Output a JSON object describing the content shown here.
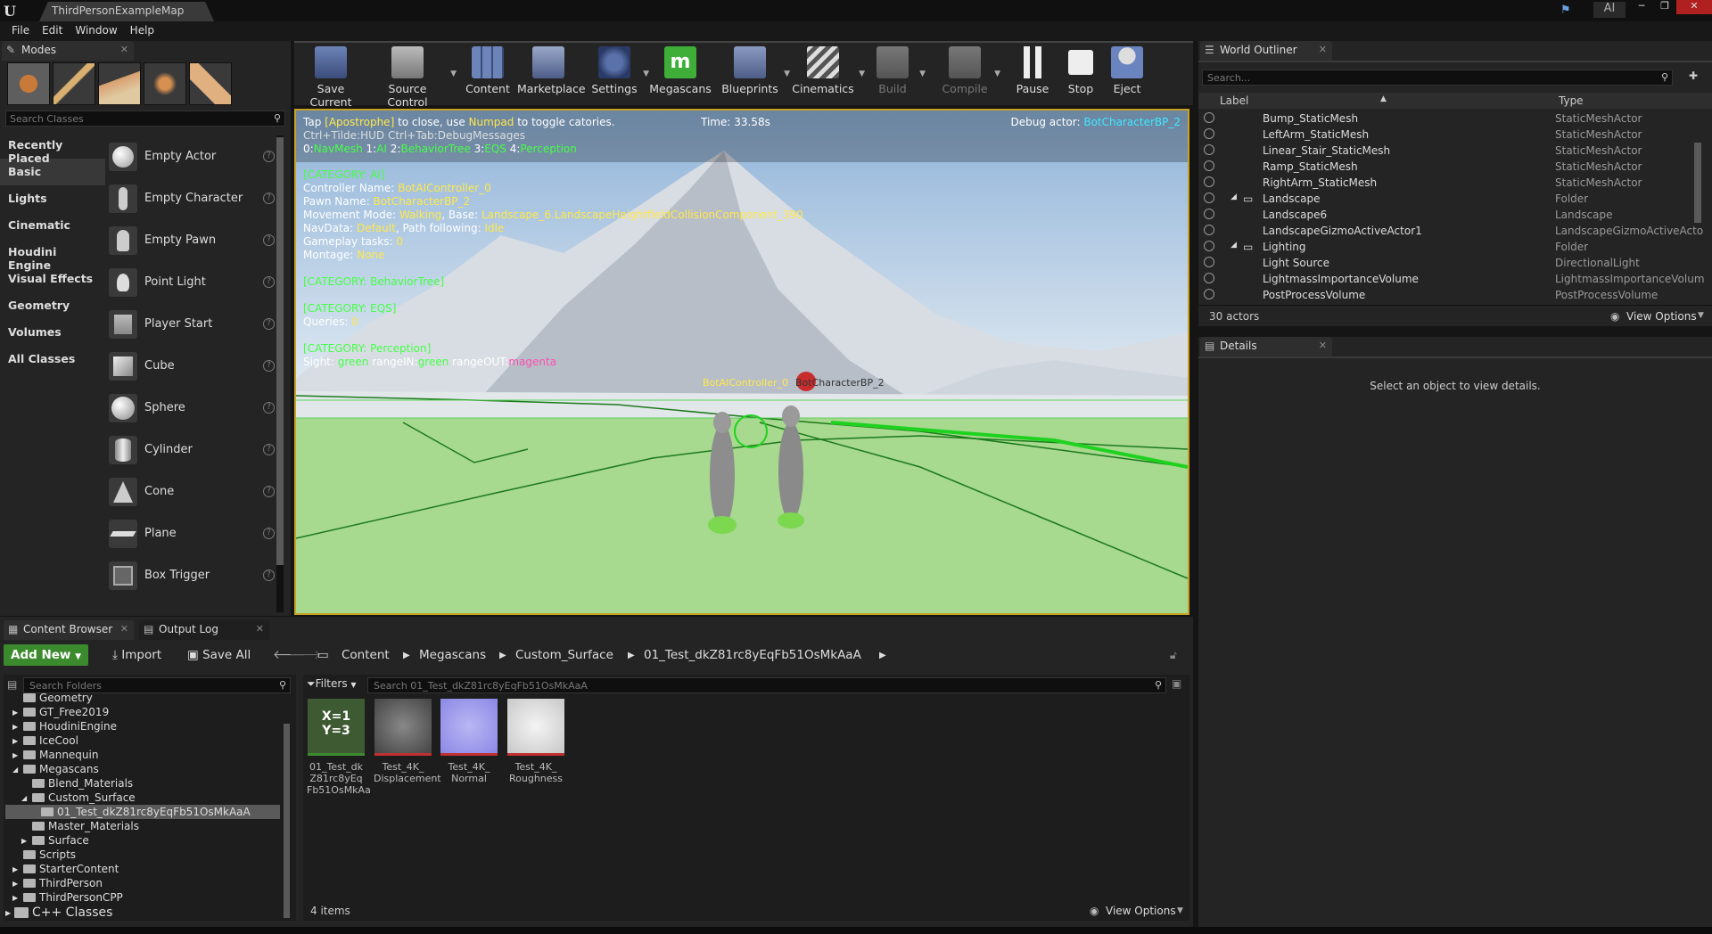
{
  "window": {
    "tab_title": "ThirdPersonExampleMap",
    "ai_label": "AI"
  },
  "menu": [
    "File",
    "Edit",
    "Window",
    "Help"
  ],
  "modes": {
    "title": "Modes",
    "search_placeholder": "Search Classes",
    "categories": [
      "Recently Placed",
      "Basic",
      "Lights",
      "Cinematic",
      "Houdini Engine",
      "Visual Effects",
      "Geometry",
      "Volumes",
      "All Classes"
    ],
    "selected_category": "Basic",
    "classes": [
      "Empty Actor",
      "Empty Character",
      "Empty Pawn",
      "Point Light",
      "Player Start",
      "Cube",
      "Sphere",
      "Cylinder",
      "Cone",
      "Plane",
      "Box Trigger"
    ]
  },
  "toolbar": {
    "save_current": "Save Current",
    "source_control": "Source Control",
    "content": "Content",
    "marketplace": "Marketplace",
    "settings": "Settings",
    "megascans": "Megascans",
    "blueprints": "Blueprints",
    "cinematics": "Cinematics",
    "build": "Build",
    "compile": "Compile",
    "pause": "Pause",
    "stop": "Stop",
    "eject": "Eject"
  },
  "viewport": {
    "hint_pre": "Tap ",
    "hint_key": "[Apostrophe]",
    "hint_mid": " to close, use ",
    "hint_numpad": "Numpad",
    "hint_post": " to toggle catories.",
    "line2": "Ctrl+Tilde:HUD  Ctrl+Tab:DebugMessages",
    "line3_0": "0:",
    "line3_navmesh": "NavMesh",
    "line3_1": " 1:",
    "line3_ai": "AI",
    "line3_2": " 2:",
    "line3_bt": "BehaviorTree",
    "line3_3": " 3:",
    "line3_eqs": "EQS",
    "line3_4": " 4:",
    "line3_perc": "Perception",
    "time": "Time: 33.58s",
    "debug_actor_label": "Debug actor: ",
    "debug_actor": "BotCharacterBP_2",
    "cat_ai": "[CATEGORY: AI]",
    "controller_label": "Controller Name: ",
    "controller": "BotAIController_0",
    "pawn_label": "Pawn Name: ",
    "pawn": "BotCharacterBP_2",
    "movement_label": "Movement Mode: ",
    "movement": "Walking",
    "base_label": ", Base: ",
    "base": "Landscape_6.LandscapeHeightfieldCollisionComponent_390",
    "navdata_label": "NavData: ",
    "navdata": "Default",
    "path_label": ", Path following: ",
    "path": "Idle",
    "gameplay_label": "Gameplay tasks: ",
    "gameplay": "0",
    "montage_label": "Montage: ",
    "montage": "None",
    "cat_bt": "[CATEGORY: BehaviorTree]",
    "cat_eqs": "[CATEGORY: EQS]",
    "queries_label": "Queries: ",
    "queries": "0",
    "cat_perc": "[CATEGORY: Perception]",
    "sight_label": "Sight: ",
    "sight": "green",
    "rangein_label": " rangeIN:",
    "rangein": "green",
    "rangeout_label": " rangeOUT:",
    "rangeout": "magenta",
    "overlay_controller": "BotAIController_0",
    "overlay_character": "BotCharacterBP_2"
  },
  "outliner": {
    "title": "World Outliner",
    "search_placeholder": "Search...",
    "col_label": "Label",
    "col_type": "Type",
    "rows": [
      {
        "label": "Bump_StaticMesh",
        "type": "StaticMeshActor"
      },
      {
        "label": "LeftArm_StaticMesh",
        "type": "StaticMeshActor"
      },
      {
        "label": "Linear_Stair_StaticMesh",
        "type": "StaticMeshActor"
      },
      {
        "label": "Ramp_StaticMesh",
        "type": "StaticMeshActor"
      },
      {
        "label": "RightArm_StaticMesh",
        "type": "StaticMeshActor"
      },
      {
        "label": "Landscape",
        "type": "Folder"
      },
      {
        "label": "Landscape6",
        "type": "Landscape"
      },
      {
        "label": "LandscapeGizmoActiveActor1",
        "type": "LandscapeGizmoActiveActo"
      },
      {
        "label": "Lighting",
        "type": "Folder"
      },
      {
        "label": "Light Source",
        "type": "DirectionalLight"
      },
      {
        "label": "LightmassImportanceVolume",
        "type": "LightmassImportanceVolum"
      },
      {
        "label": "PostProcessVolume",
        "type": "PostProcessVolume"
      }
    ],
    "count": "30 actors",
    "view_options": "View Options"
  },
  "details": {
    "title": "Details",
    "empty": "Select an object to view details."
  },
  "content_browser": {
    "tab": "Content Browser",
    "output_tab": "Output Log",
    "add_new": "Add New",
    "import": "Import",
    "save_all": "Save All",
    "crumbs": [
      "Content",
      "Megascans",
      "Custom_Surface",
      "01_Test_dkZ81rc8yEqFb51OsMkAaA"
    ],
    "folder_search": "Search Folders",
    "filters": "Filters",
    "asset_search": "Search 01_Test_dkZ81rc8yEqFb51OsMkAaA",
    "folders": [
      "Geometry",
      "GT_Free2019",
      "HoudiniEngine",
      "IceCool",
      "Mannequin",
      "Megascans",
      "Blend_Materials",
      "Custom_Surface",
      "01_Test_dkZ81rc8yEqFb51OsMkAaA",
      "Master_Materials",
      "Surface",
      "Scripts",
      "StarterContent",
      "ThirdPerson",
      "ThirdPersonCPP",
      "C++ Classes"
    ],
    "assets": [
      {
        "name": "01_Test_dk Z81rc8yEq Fb51OsMkAa",
        "thumb": "X=1 Y=3"
      },
      {
        "name": "Test_4K_ Displacement",
        "thumb": ""
      },
      {
        "name": "Test_4K_ Normal",
        "thumb": ""
      },
      {
        "name": "Test_4K_ Roughness",
        "thumb": ""
      }
    ],
    "items": "4 items",
    "view_options": "View Options"
  }
}
